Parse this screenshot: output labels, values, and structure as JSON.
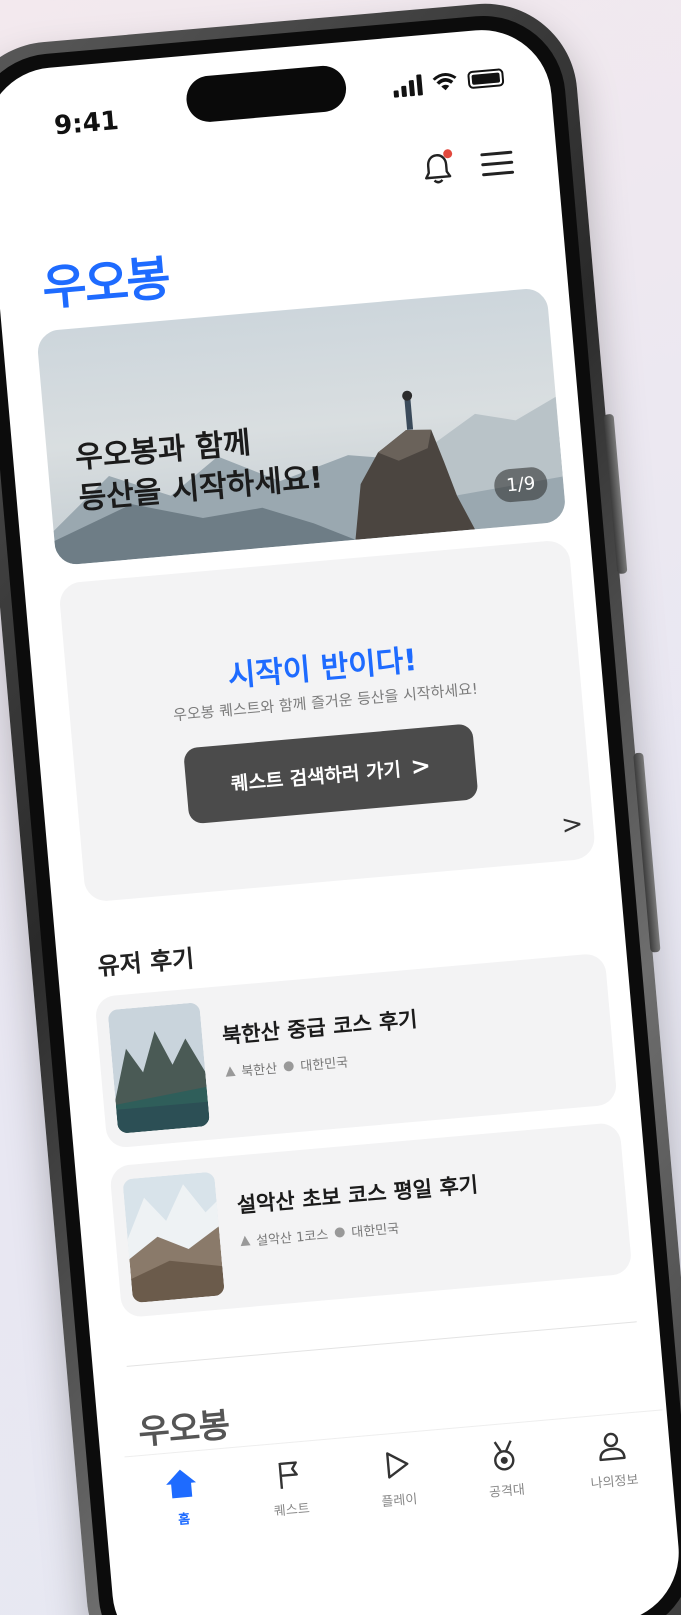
{
  "status": {
    "time": "9:41"
  },
  "header": {
    "logo": "우오봉"
  },
  "banner": {
    "line1": "우오봉과 함께",
    "line2": "등산을 시작하세요!",
    "counter": "1/9"
  },
  "start_card": {
    "title": "시작이 반이다!",
    "subtitle": "우오봉 퀘스트와 함께 즐거운 등산을 시작하세요!",
    "button_label": "퀘스트 검색하러 가기",
    "chevron": ">",
    "more_chevron": ">"
  },
  "reviews": {
    "section_title": "유저 후기",
    "items": [
      {
        "title": "북한산 중급 코스 후기",
        "mountain": "북한산",
        "location": "대한민국"
      },
      {
        "title": "설악산 초보 코스 평일 후기",
        "mountain": "설악산 1코스",
        "location": "대한민국"
      }
    ]
  },
  "footer": {
    "logo": "우오봉"
  },
  "tabbar": {
    "items": [
      {
        "label": "홈",
        "icon": "home-icon"
      },
      {
        "label": "퀘스트",
        "icon": "flag-icon"
      },
      {
        "label": "플레이",
        "icon": "play-icon"
      },
      {
        "label": "공격대",
        "icon": "medal-icon"
      },
      {
        "label": "나의정보",
        "icon": "user-icon"
      }
    ]
  },
  "colors": {
    "brand": "#1e6bff",
    "notification_dot": "#e2483d",
    "button": "#4b4b4b"
  }
}
